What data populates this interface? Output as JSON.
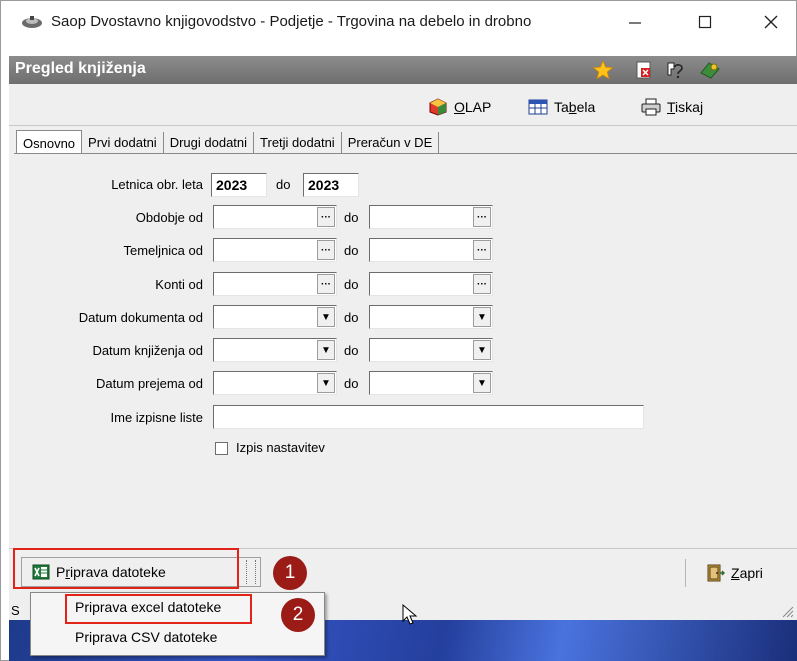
{
  "window": {
    "title": "Saop Dvostavno knjigovodstvo - Podjetje - Trgovina na debelo in drobno",
    "minimize_glyph": "—",
    "maximize_glyph": "☐",
    "close_glyph": "✕"
  },
  "form": {
    "title": "Pregled knjiženja",
    "header_icons": [
      "star-icon",
      "close-form-icon",
      "help-icon",
      "tools-icon"
    ]
  },
  "toolbar": {
    "olap": {
      "prefix": "",
      "accel": "O",
      "rest": "LAP"
    },
    "tabela": {
      "prefix": "Ta",
      "accel": "b",
      "rest": "ela"
    },
    "tiskaj": {
      "prefix": "",
      "accel": "T",
      "rest": "iskaj"
    }
  },
  "tabs": [
    "Osnovno",
    "Prvi dodatni",
    "Drugi dodatni",
    "Tretji dodatni",
    "Preračun v DE"
  ],
  "fields": {
    "letnica_label": "Letnica obr. leta",
    "letnica_from": "2023",
    "letnica_do": "do",
    "letnica_to": "2023",
    "obdobje_label": "Obdobje od",
    "temeljnica_label": "Temeljnica od",
    "konti_label": "Konti od",
    "datum_dokumenta_label": "Datum dokumenta od",
    "datum_knjizenja_label": "Datum knjiženja od",
    "datum_prejema_label": "Datum prejema od",
    "do_label": "do",
    "ime_izpisne_liste_label": "Ime izpisne liste",
    "ime_izpisne_liste_value": "",
    "izpis_nastavitev_label": "Izpis nastavitev",
    "ellipsis_glyph": "···",
    "dropdown_glyph": "▼"
  },
  "bottom": {
    "priprava": {
      "prefix": "P",
      "accel": "r",
      "rest": "iprava datoteke"
    },
    "zapri": {
      "prefix": "",
      "accel": "Z",
      "rest": "apri"
    },
    "badge_1": "1",
    "badge_2": "2",
    "status_char": "S"
  },
  "context_menu": {
    "items": [
      "Priprava excel datoteke",
      "Priprava CSV datoteke"
    ]
  },
  "colors": {
    "highlight_red": "#e2231a",
    "badge": "#9b1b17",
    "form_header": "#7a7a7a"
  }
}
